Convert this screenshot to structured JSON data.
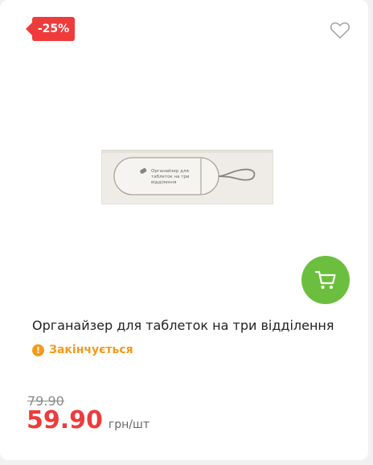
{
  "badge": {
    "discount": "-25%"
  },
  "product": {
    "title": "Органайзер для таблеток на три відділення",
    "image_label_line1": "Органайзер для",
    "image_label_line2": "таблеток на три",
    "image_label_line3": "відділення"
  },
  "stock": {
    "status": "Закінчується"
  },
  "pricing": {
    "old_price": "79.90",
    "current_price": "59.90",
    "unit": "грн/шт"
  },
  "colors": {
    "accent_red": "#ef3b3b",
    "cart_green": "#6cbf3e",
    "stock_orange": "#f49a1a"
  },
  "icons": {
    "wishlist": "heart-icon",
    "cart": "cart-icon",
    "stock": "alert-icon"
  }
}
